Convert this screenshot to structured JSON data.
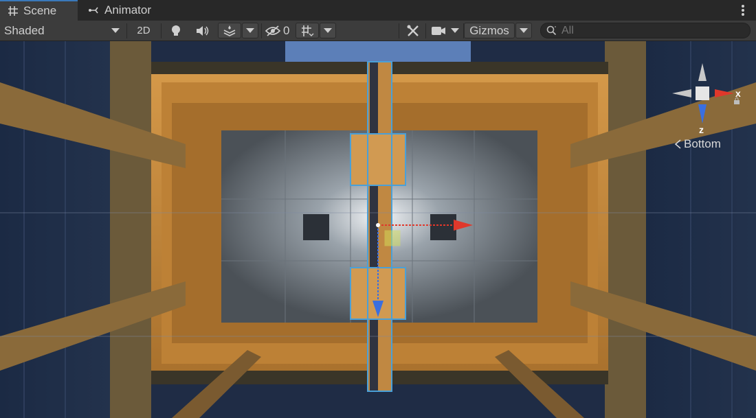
{
  "tabs": [
    {
      "label": "Scene",
      "icon": "grid-hash-icon",
      "active": true
    },
    {
      "label": "Animator",
      "icon": "animator-icon",
      "active": false
    }
  ],
  "toolbar": {
    "shading_mode": "Shaded",
    "mode_2d": "2D",
    "hidden_count": "0",
    "gizmos_label": "Gizmos",
    "search_placeholder": "All"
  },
  "gizmo": {
    "x_label": "x",
    "z_label": "z",
    "view_label": "Bottom"
  },
  "colors": {
    "accent_blue": "#3a79bb",
    "axis_x": "#e0382b",
    "axis_y": "#c8c8c8",
    "axis_z": "#3a6fe0",
    "panel_orange": "#c98a3a"
  }
}
